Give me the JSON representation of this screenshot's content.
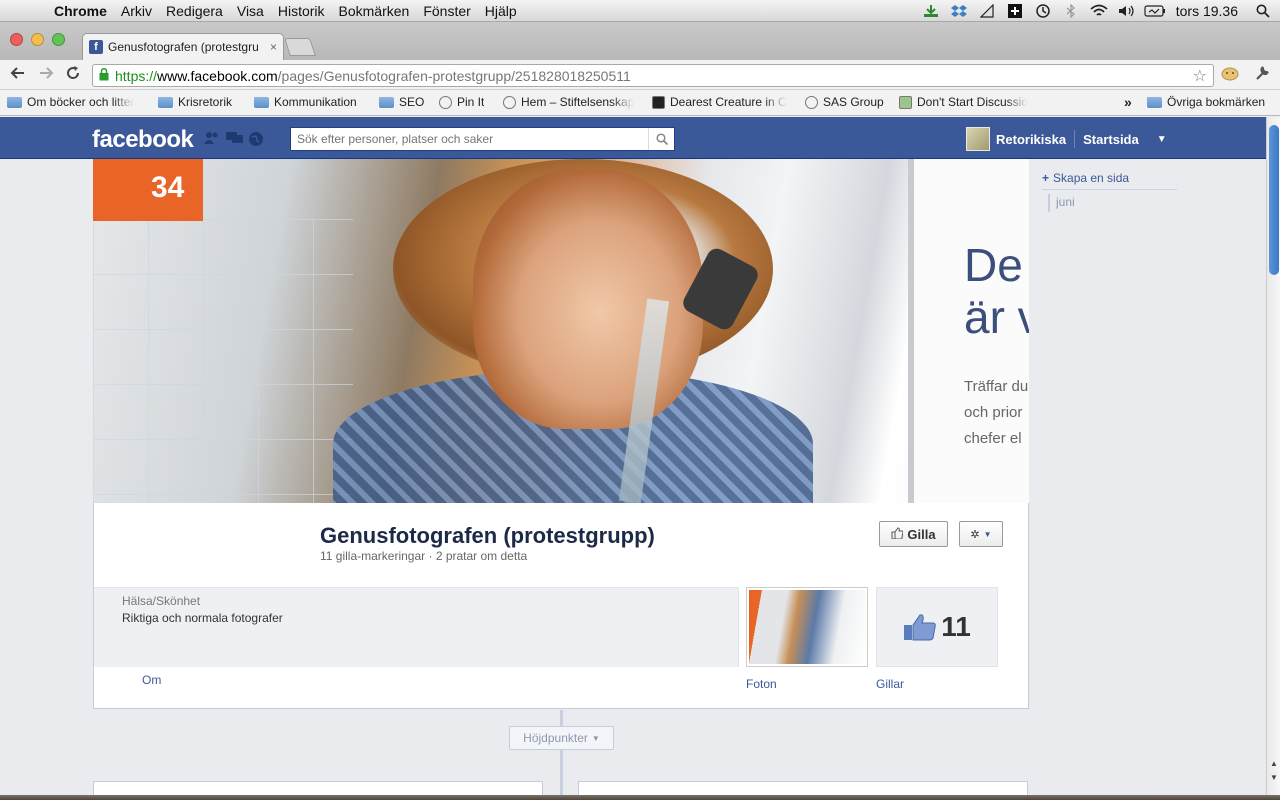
{
  "menubar": {
    "app_name": "Chrome",
    "items": [
      "Arkiv",
      "Redigera",
      "Visa",
      "Historik",
      "Bokmärken",
      "Fönster",
      "Hjälp"
    ],
    "clock": "tors 19.36",
    "tray_icons": [
      "download-icon",
      "dropbox-icon",
      "notes-icon",
      "plus-app-icon",
      "time-machine-icon",
      "bluetooth-icon",
      "wifi-icon",
      "volume-icon",
      "battery-icon"
    ]
  },
  "tab": {
    "title": "Genusfotografen (protestgru",
    "close_label": "×"
  },
  "omnibox": {
    "scheme": "https://",
    "host": "www.facebook.com",
    "path": "/pages/Genusfotografen-protestgrupp/251828018250511"
  },
  "bookmarks": {
    "items": [
      {
        "label": "Om böcker och litter",
        "icon": "folder-icon"
      },
      {
        "label": "Krisretorik",
        "icon": "folder-icon"
      },
      {
        "label": "Kommunikation",
        "icon": "folder-icon"
      },
      {
        "label": "SEO",
        "icon": "folder-icon"
      },
      {
        "label": "Pin It",
        "icon": "globe-icon"
      },
      {
        "label": "Hem – Stiftelsenskap",
        "icon": "globe-icon"
      },
      {
        "label": "Dearest Creature in C",
        "icon": "site-icon"
      },
      {
        "label": "SAS Group",
        "icon": "globe-icon"
      },
      {
        "label": "Don't Start Discussio",
        "icon": "site-icon"
      }
    ],
    "overflow": "»",
    "other": "Övriga bokmärken"
  },
  "facebook": {
    "logo": "facebook",
    "search_placeholder": "Sök efter personer, platser och saker",
    "user_name": "Retorikiska",
    "home_link": "Startsida",
    "accent": "#3b5998"
  },
  "page": {
    "name": "Genusfotografen (protestgrupp)",
    "meta": "11 gilla-markeringar · 2 pratar om detta",
    "like_button": "Gilla",
    "category": "Hälsa/Skönhet",
    "description": "Riktiga och normala fotografer",
    "about_link": "Om",
    "photos_link": "Foton",
    "likes_link": "Gillar",
    "likes_count": "11",
    "highlights": "Höjdpunkter"
  },
  "cover": {
    "sign_number": "34",
    "poster_big": "De\när v",
    "poster_small": "Träffar du\noch prior\nchefer el"
  },
  "right_col": {
    "create_page": "Skapa en sida",
    "month": "juni"
  }
}
